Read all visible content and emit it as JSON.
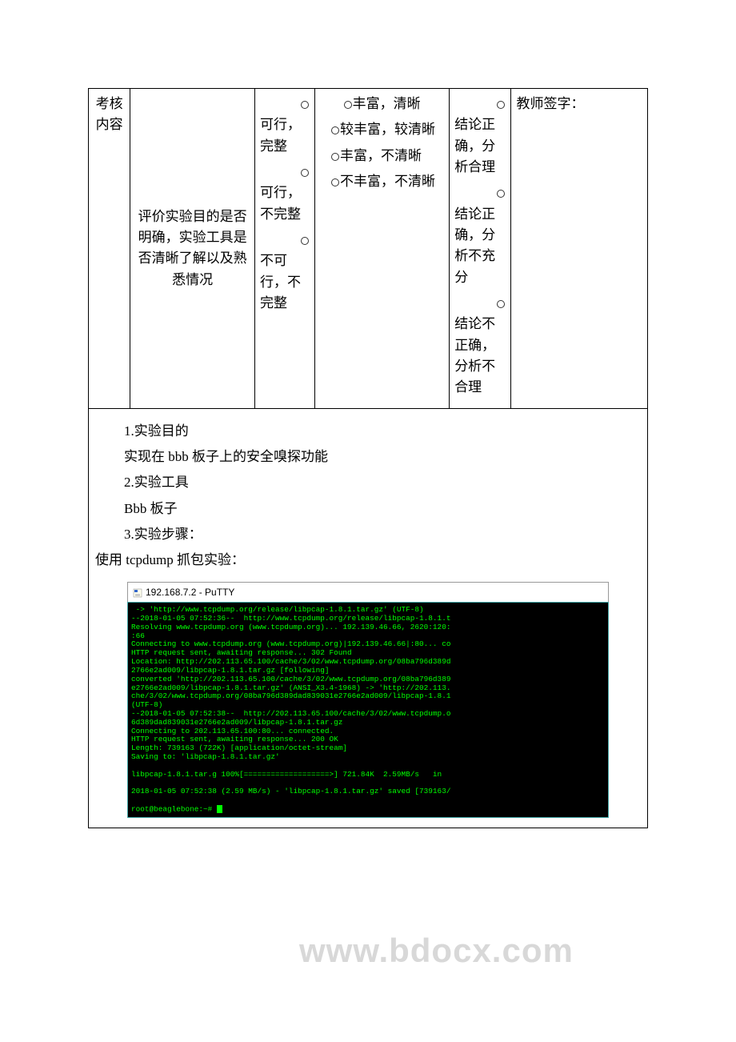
{
  "table": {
    "row1": {
      "col1": "考核内容",
      "col2": "评价实验目的是否明确，实验工具是否清晰了解以及熟悉情况",
      "col3": {
        "opt1": "可行，完整",
        "opt2": "可行，不完整",
        "opt3": "不可行，不完整"
      },
      "col4": {
        "opt1": "丰富，清晰",
        "opt2": "较丰富，较清晰",
        "opt3": "丰富，不清晰",
        "opt4": "不丰富，不清晰"
      },
      "col5": {
        "opt1": "结论正确，分析合理",
        "opt2": "结论正确，分析不充分",
        "opt3": "结论不正确，分析不合理"
      },
      "col6": "教师签字："
    }
  },
  "content": {
    "l1": "1.实验目的",
    "l2": "实现在 bbb 板子上的安全嗅探功能",
    "l3": "2.实验工具",
    "l4": "Bbb 板子",
    "l5": "3.实验步骤：",
    "l6": "使用 tcpdump 抓包实验："
  },
  "watermark": "www.bdocx.com",
  "terminal": {
    "title": "192.168.7.2 - PuTTY",
    "lines": [
      " -> 'http://www.tcpdump.org/release/libpcap-1.8.1.tar.gz' (UTF-8)",
      "--2018-01-05 07:52:36--  http://www.tcpdump.org/release/libpcap-1.8.1.t",
      "Resolving www.tcpdump.org (www.tcpdump.org)... 192.139.46.66, 2620:120:",
      ":66",
      "Connecting to www.tcpdump.org (www.tcpdump.org)|192.139.46.66|:80... co",
      "HTTP request sent, awaiting response... 302 Found",
      "Location: http://202.113.65.100/cache/3/02/www.tcpdump.org/08ba796d389d",
      "2766e2ad009/libpcap-1.8.1.tar.gz [following]",
      "converted 'http://202.113.65.100/cache/3/02/www.tcpdump.org/08ba796d389",
      "e2766e2ad009/libpcap-1.8.1.tar.gz' (ANSI_X3.4-1968) -> 'http://202.113.",
      "che/3/02/www.tcpdump.org/08ba796d389dad839031e2766e2ad009/libpcap-1.8.1",
      "(UTF-8)",
      "--2018-01-05 07:52:38--  http://202.113.65.100/cache/3/02/www.tcpdump.o",
      "6d389dad839031e2766e2ad009/libpcap-1.8.1.tar.gz",
      "Connecting to 202.113.65.100:80... connected.",
      "HTTP request sent, awaiting response... 200 OK",
      "Length: 739163 (722K) [application/octet-stream]",
      "Saving to: 'libpcap-1.8.1.tar.gz'",
      "",
      "libpcap-1.8.1.tar.g 100%[===================>] 721.84K  2.59MB/s   in",
      "",
      "2018-01-05 07:52:38 (2.59 MB/s) - 'libpcap-1.8.1.tar.gz' saved [739163/",
      "",
      "root@beaglebone:~# "
    ]
  }
}
